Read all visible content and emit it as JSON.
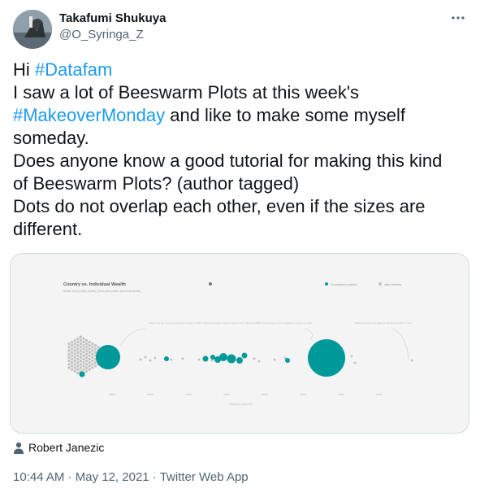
{
  "author": {
    "display_name": "Takafumi Shukuya",
    "handle": "@O_Syringa_Z",
    "avatar_icon": "avatar-photo"
  },
  "more_menu_icon": "more-horizontal-icon",
  "tweet": {
    "greeting": "Hi ",
    "hashtag_datafam": "#Datafam",
    "line2": "I saw a lot of Beeswarm Plots at this week's",
    "hashtag_makeover": "#MakeoverMonday",
    "line3_rest": " and like to make some myself",
    "line4": "someday.",
    "line5": "Does anyone know a good tutorial for making this kind",
    "line6": "of Beeswarm Plots? (author tagged)",
    "line7": "Dots do not overlap each other, even if the sizes are",
    "line8": "different."
  },
  "media": {
    "image_title": "Country vs. Individual Wealth",
    "image_subtitle": "Bubble size (country wealth) | Horizontal position (individual wealth)",
    "legend_teal": "10 wealthiest countries",
    "legend_grey": "other countries",
    "x_axis_label": "Wealth per person $",
    "annotation_1": "Shown are the second wealthiest country in 2019. Individual wealth however was a much different story",
    "annotation_2": "The United States is the wealthiest country on earth",
    "annotation_3": "Switzerland has the highest individual wealth of earth",
    "accent_color": "#00999a",
    "dot_color": "#c4c4c4"
  },
  "tagged": {
    "icon": "person-icon",
    "name": "Robert Janezic"
  },
  "meta": {
    "time": "10:44 AM",
    "separator": " · ",
    "date": "May 12, 2021",
    "source": "Twitter Web App"
  }
}
